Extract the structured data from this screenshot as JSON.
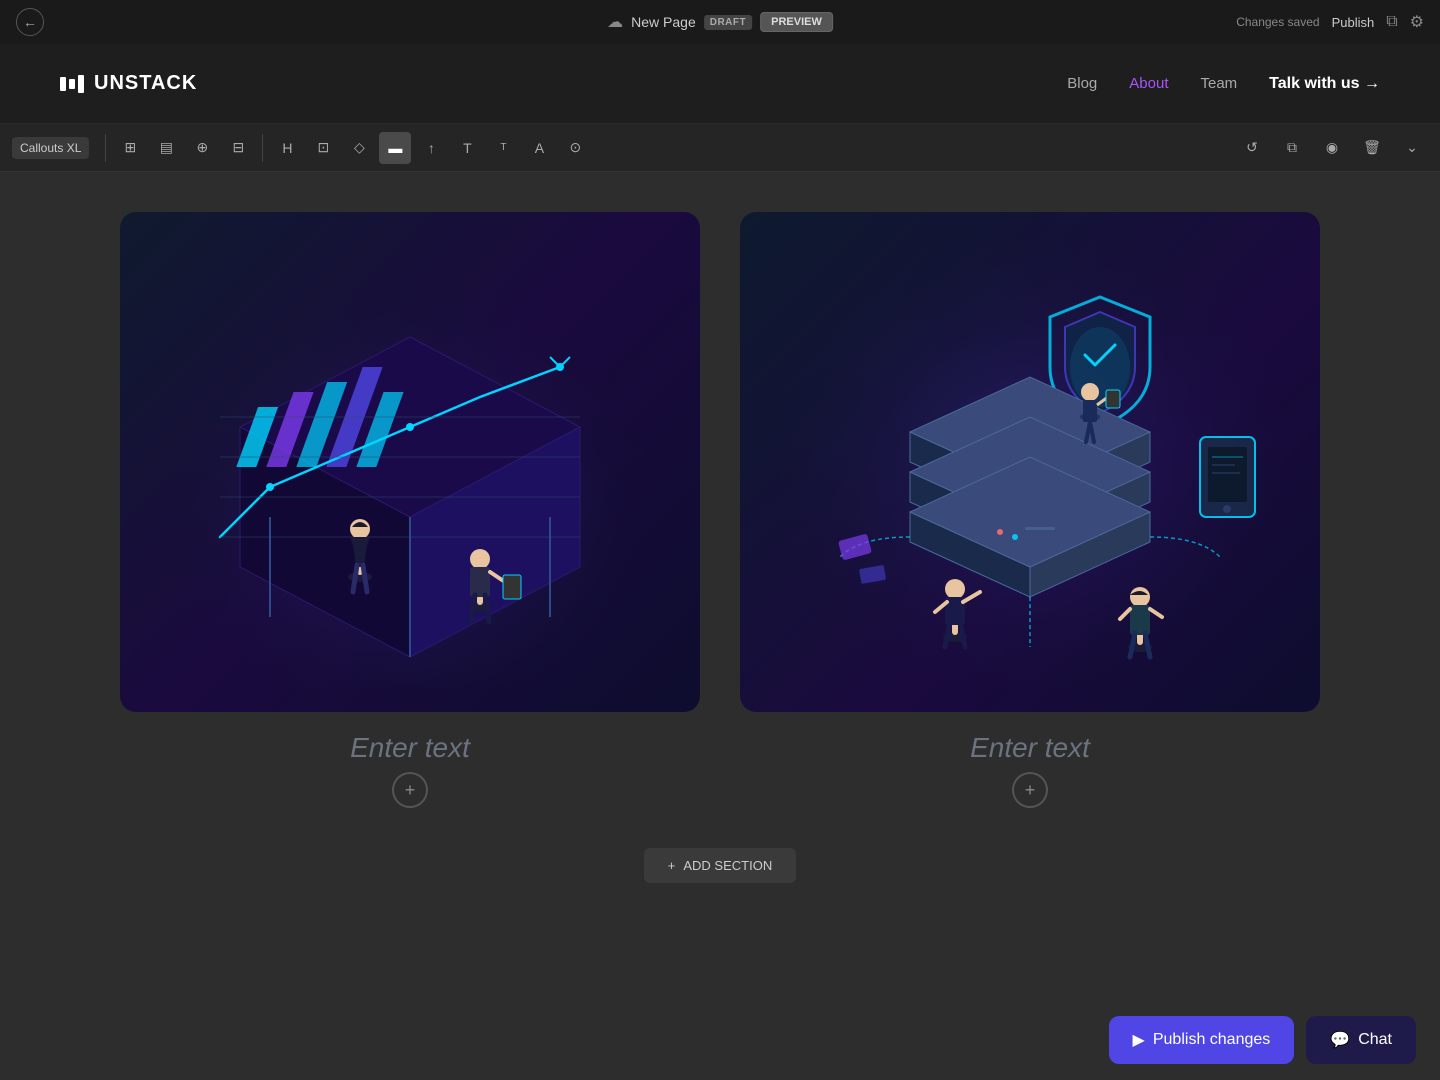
{
  "topbar": {
    "back_title": "Back",
    "page_icon": "☁",
    "page_title": "New Page",
    "draft_label": "DRAFT",
    "preview_label": "PREVIEW",
    "changes_saved": "Changes saved",
    "publish_label": "Publish",
    "settings_icon": "gear",
    "duplicate_icon": "duplicate"
  },
  "navbar": {
    "logo_text": "UNSTACK",
    "nav_items": [
      {
        "label": "Blog",
        "active": false
      },
      {
        "label": "About",
        "active": true
      },
      {
        "label": "Team",
        "active": false
      }
    ],
    "cta_label": "Talk with us →"
  },
  "toolbar": {
    "section_label": "Callouts XL",
    "icons": [
      "grid",
      "layout",
      "move",
      "columns",
      "heading",
      "image",
      "shape",
      "highlight",
      "upload",
      "text-t",
      "text-T",
      "palette",
      "copy"
    ],
    "right_icons": [
      "undo",
      "duplicate",
      "preview",
      "delete"
    ]
  },
  "content": {
    "cards": [
      {
        "image_type": "analytics",
        "placeholder_text": "Enter text",
        "add_icon": "+"
      },
      {
        "image_type": "security",
        "placeholder_text": "Enter text",
        "add_icon": "+"
      }
    ],
    "add_section_label": "ADD SECTION",
    "add_section_icon": "+"
  },
  "bottom_bar": {
    "publish_icon": "▶",
    "publish_label": "Publish changes",
    "chat_icon": "💬",
    "chat_label": "Chat"
  }
}
